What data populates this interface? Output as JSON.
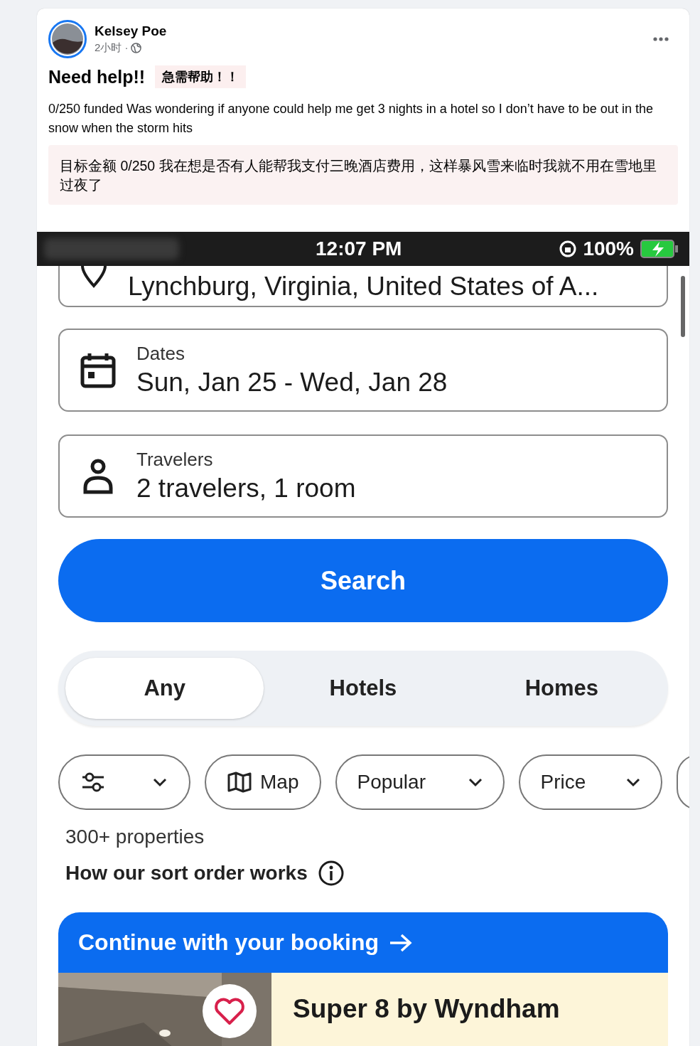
{
  "post": {
    "author": "Kelsey Poe",
    "time": "2小时 ·",
    "title": "Need help!!",
    "title_translation": "急需帮助！！",
    "body": "0/250 funded Was wondering if anyone could help me get 3 nights in a hotel so I don’t have to be out in the snow when the storm hits",
    "body_translation": "目标金额 0/250 我在想是否有人能帮我支付三晚酒店费用，这样暴风雪来临时我就不用在雪地里过夜了"
  },
  "app": {
    "status_bar": {
      "time": "12:07 PM",
      "battery": "100%"
    },
    "location": {
      "value": "Lynchburg, Virginia, United States of A..."
    },
    "dates": {
      "label": "Dates",
      "value": "Sun, Jan 25 - Wed, Jan 28"
    },
    "travelers": {
      "label": "Travelers",
      "value": "2 travelers, 1 room"
    },
    "search_button": "Search",
    "tabs": [
      {
        "label": "Any",
        "selected": true
      },
      {
        "label": "Hotels",
        "selected": false
      },
      {
        "label": "Homes",
        "selected": false
      }
    ],
    "filters": [
      {
        "kind": "filters"
      },
      {
        "kind": "map",
        "label": "Map"
      },
      {
        "kind": "dropdown",
        "label": "Popular"
      },
      {
        "kind": "dropdown",
        "label": "Price"
      },
      {
        "kind": "partial"
      }
    ],
    "results_count": "300+ properties",
    "sort_info": "How our sort order works",
    "booking": {
      "header": "Continue with your booking",
      "hotel_name": "Super 8 by Wyndham"
    }
  }
}
